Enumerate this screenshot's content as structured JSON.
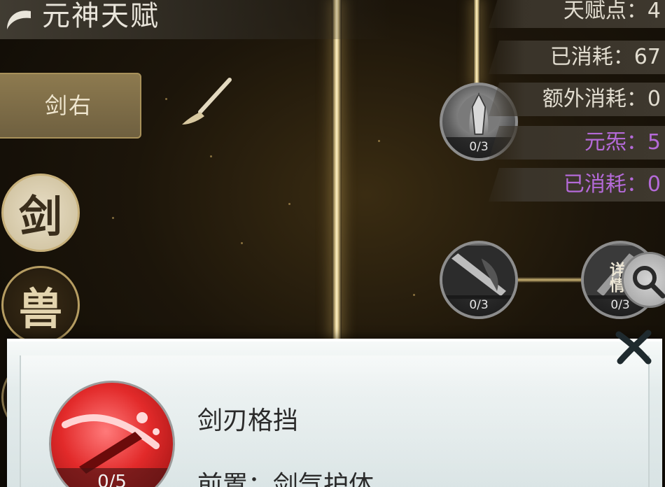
{
  "header": {
    "title": "元神天赋"
  },
  "left": {
    "preset_label": "剑右",
    "categories": [
      "剑",
      "兽"
    ]
  },
  "stats": {
    "talent_points": "天赋点：4",
    "spent": "已消耗：67",
    "extra_spent": "额外消耗：0",
    "yuanxi": "元炁：5",
    "yuanxi_spent": "已消耗：0"
  },
  "nodes": [
    {
      "level": "0/3",
      "icon": "sword-emblem-icon"
    },
    {
      "level": "0/3",
      "icon": "blade-slash-icon"
    },
    {
      "level": "0/3",
      "icon": "dark-blade-icon"
    }
  ],
  "actions": {
    "detail_label": "详情"
  },
  "popup": {
    "skill_level": "0/5",
    "skill_name": "剑刃格挡",
    "prerequisite": "前置：剑气护体"
  },
  "colors": {
    "accent_gold": "#d9c48a",
    "yuanxi_purple": "#b46ad8",
    "skill_red": "#e22a2a",
    "popup_bg": "#e4ecec"
  }
}
